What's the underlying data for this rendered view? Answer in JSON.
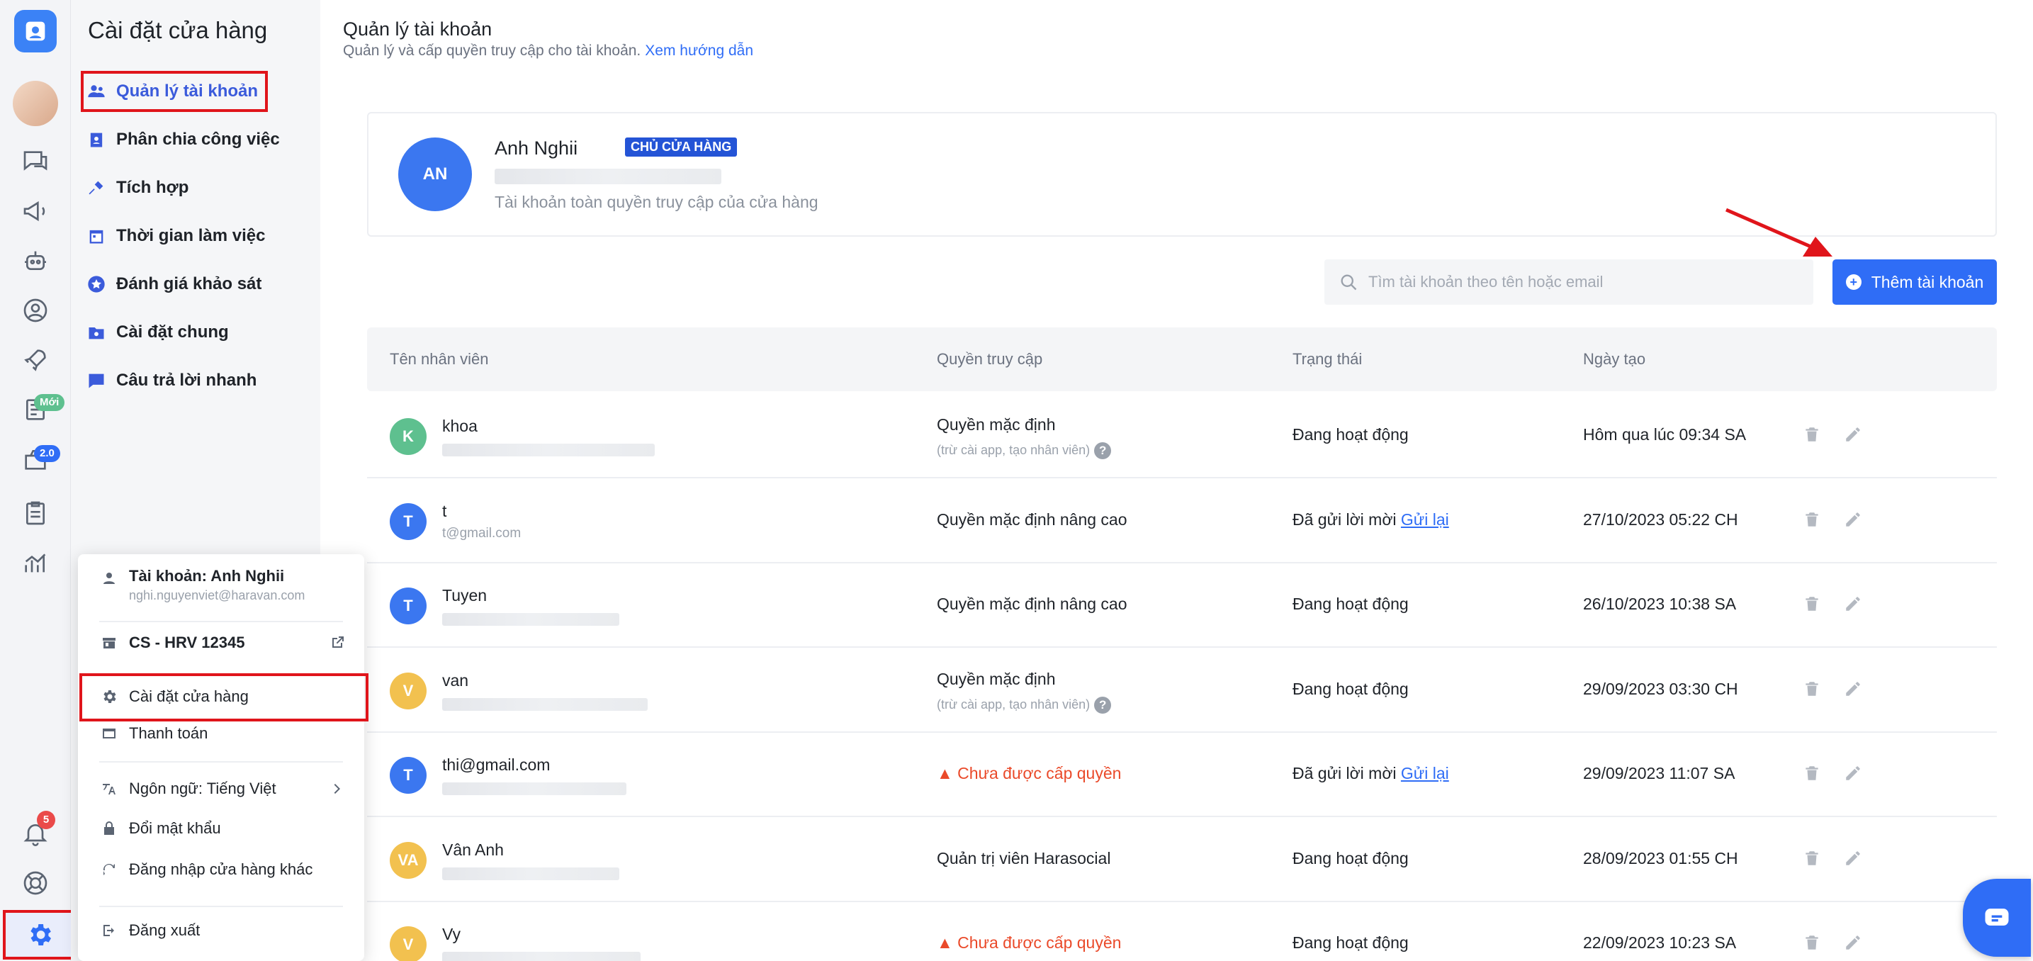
{
  "rail": {
    "badges": {
      "new": "Mới",
      "version": "2.0",
      "notifications": "5"
    }
  },
  "sidebar": {
    "title": "Cài đặt cửa hàng",
    "items": [
      {
        "label": "Quản lý tài khoản",
        "icon": "users-icon"
      },
      {
        "label": "Phân chia công việc",
        "icon": "badge-icon"
      },
      {
        "label": "Tích hợp",
        "icon": "plug-icon"
      },
      {
        "label": "Thời gian làm việc",
        "icon": "calendar-icon"
      },
      {
        "label": "Đánh giá khảo sát",
        "icon": "star-icon"
      },
      {
        "label": "Cài đặt chung",
        "icon": "folder-gear-icon"
      },
      {
        "label": "Câu trả lời nhanh",
        "icon": "chat-icon"
      }
    ]
  },
  "header": {
    "title": "Quản lý tài khoản",
    "subtitle": "Quản lý và cấp quyền truy cập cho tài khoản.",
    "guide_link": "Xem hướng dẫn"
  },
  "owner": {
    "initials": "AN",
    "name": "Anh Nghii",
    "tag": "CHỦ CỬA HÀNG",
    "description": "Tài khoản toàn quyền truy cập của cửa hàng"
  },
  "search": {
    "placeholder": "Tìm tài khoản theo tên hoặc email"
  },
  "add_button": {
    "label": "Thêm tài khoản"
  },
  "table": {
    "columns": [
      "Tên nhân viên",
      "Quyền truy cập",
      "Trạng thái",
      "Ngày tạo"
    ],
    "rows": [
      {
        "initials": "K",
        "name": "khoa",
        "email": "",
        "permission": "Quyền mặc định",
        "permission_note": "(trừ cài app, tạo nhân viên)",
        "status": "Đang hoạt động",
        "resend": "",
        "created": "Hôm qua lúc 09:34 SA",
        "avatar_color": "#5ec08f"
      },
      {
        "initials": "T",
        "name": "t",
        "email": "t@gmail.com",
        "permission": "Quyền mặc định nâng cao",
        "permission_note": "",
        "status": "Đã gửi lời mời",
        "resend": "Gửi lại",
        "created": "27/10/2023 05:22 CH",
        "avatar_color": "#3b77f0"
      },
      {
        "initials": "T",
        "name": "Tuyen",
        "email": "",
        "permission": "Quyền mặc định nâng cao",
        "permission_note": "",
        "status": "Đang hoạt động",
        "resend": "",
        "created": "26/10/2023 10:38 SA",
        "avatar_color": "#3b77f0"
      },
      {
        "initials": "V",
        "name": "van",
        "email": "",
        "permission": "Quyền mặc định",
        "permission_note": "(trừ cài app, tạo nhân viên)",
        "status": "Đang hoạt động",
        "resend": "",
        "created": "29/09/2023 03:30 CH",
        "avatar_color": "#f2c14f"
      },
      {
        "initials": "T",
        "name": "thi@gmail.com",
        "email": "",
        "permission": "Chưa được cấp quyền",
        "permission_note": "",
        "status": "Đã gửi lời mời",
        "resend": "Gửi lại",
        "created": "29/09/2023 11:07 SA",
        "avatar_color": "#3b77f0",
        "warning": true
      },
      {
        "initials": "VA",
        "name": "Vân Anh",
        "email": "",
        "permission": "Quản trị viên Harasocial",
        "permission_note": "",
        "status": "Đang hoạt động",
        "resend": "",
        "created": "28/09/2023 01:55 CH",
        "avatar_color": "#f2c14f"
      },
      {
        "initials": "V",
        "name": "Vy",
        "email": "",
        "permission": "Chưa được cấp quyền",
        "permission_note": "",
        "status": "Đang hoạt động",
        "resend": "",
        "created": "22/09/2023 10:23 SA",
        "avatar_color": "#f2c14f",
        "warning": true
      }
    ]
  },
  "user_menu": {
    "account_label": "Tài khoản: Anh Nghii",
    "account_email": "nghi.nguyenviet@haravan.com",
    "store": "CS - HRV 12345",
    "store_settings": "Cài đặt cửa hàng",
    "billing": "Thanh toán",
    "language": "Ngôn ngữ: Tiếng Việt",
    "change_password": "Đổi mật khẩu",
    "switch_store": "Đăng nhập cửa hàng khác",
    "logout": "Đăng xuất"
  },
  "colors": {
    "accent": "#2f6df6",
    "highlight": "#e0151b",
    "warning": "#ea4a2a"
  }
}
